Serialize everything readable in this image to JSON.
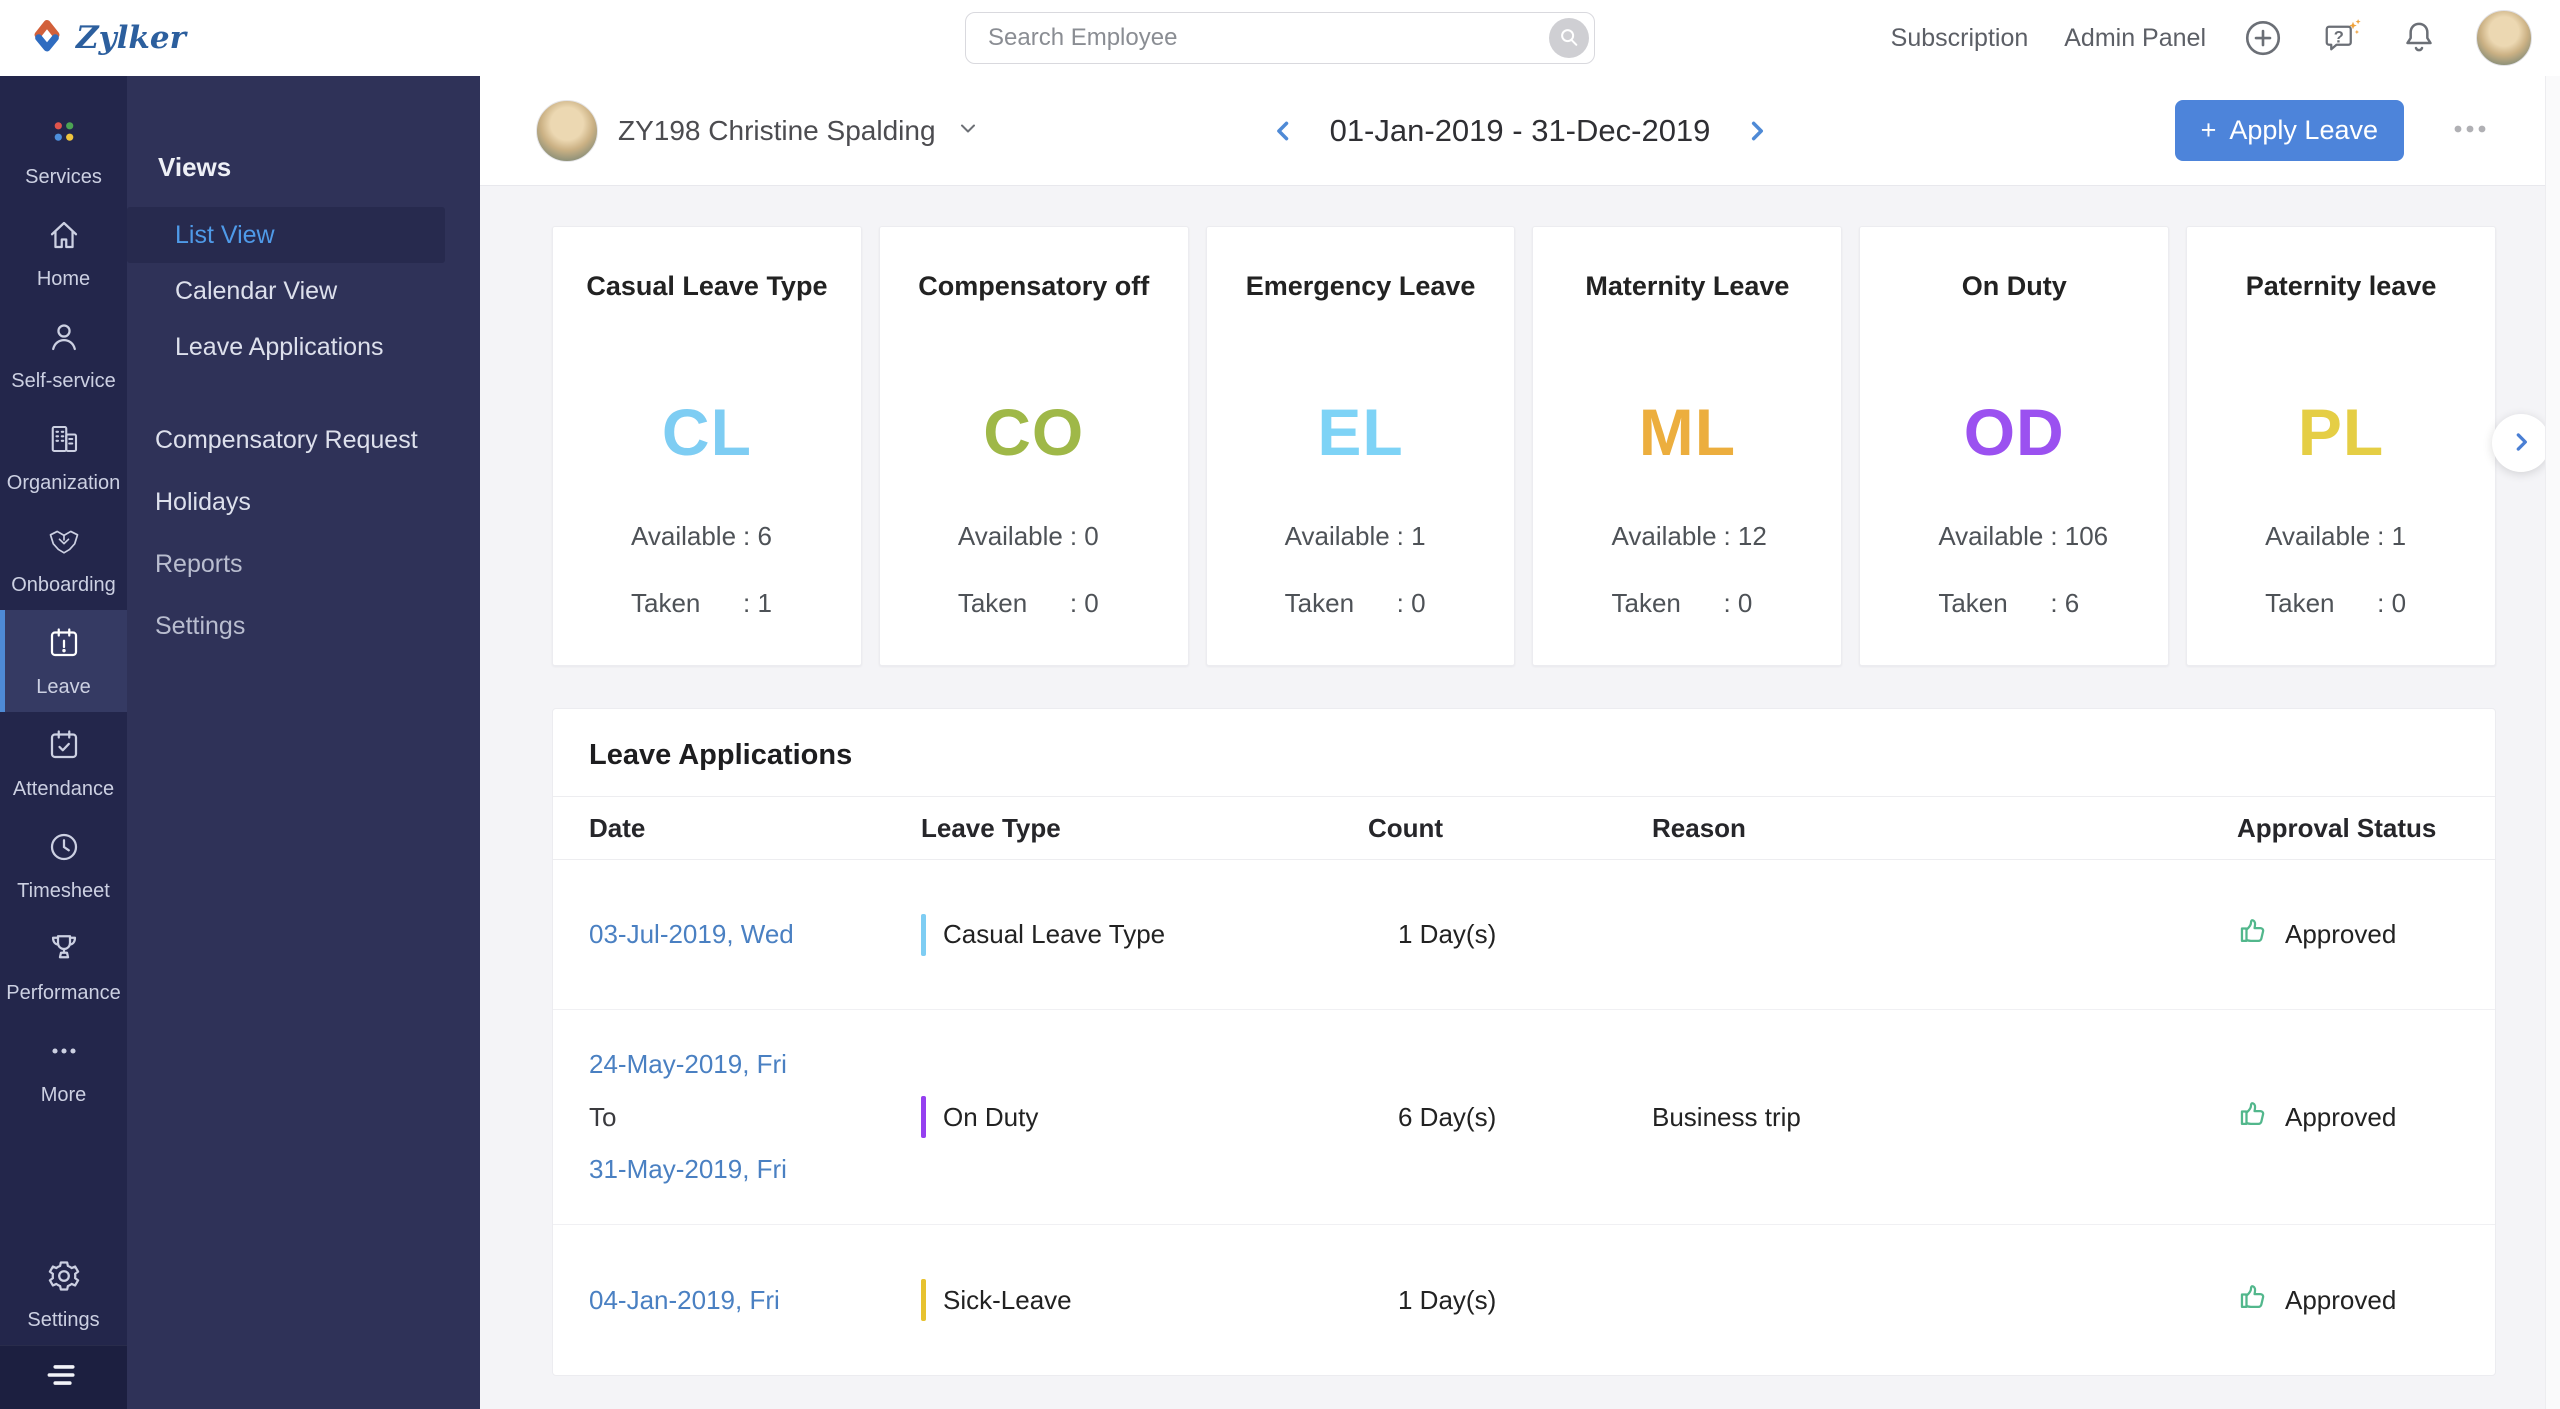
{
  "colors": {
    "accent_blue": "#4d84da",
    "link_blue": "#4a80c2",
    "approved_green": "#52b78c",
    "logo_blue": "#2c5f9e"
  },
  "topbar": {
    "logo_text": "Zylker",
    "search_placeholder": "Search Employee",
    "links": [
      {
        "label": "Subscription"
      },
      {
        "label": "Admin Panel"
      }
    ],
    "icons": [
      "plus-circle-icon",
      "help-bubble-icon",
      "bell-icon",
      "user-avatar"
    ]
  },
  "sidebar": {
    "items": [
      {
        "label": "Services",
        "icon": "services-grid-icon",
        "active": false
      },
      {
        "label": "Home",
        "icon": "home-icon",
        "active": false
      },
      {
        "label": "Self-service",
        "icon": "person-icon",
        "active": false
      },
      {
        "label": "Organization",
        "icon": "buildings-icon",
        "active": false
      },
      {
        "label": "Onboarding",
        "icon": "handshake-icon",
        "active": false
      },
      {
        "label": "Leave",
        "icon": "calendar-exclaim-icon",
        "active": true
      },
      {
        "label": "Attendance",
        "icon": "calendar-check-icon",
        "active": false
      },
      {
        "label": "Timesheet",
        "icon": "clock-icon",
        "active": false
      },
      {
        "label": "Performance",
        "icon": "trophy-icon",
        "active": false
      },
      {
        "label": "More",
        "icon": "ellipsis-icon",
        "active": false
      }
    ],
    "settings_label": "Settings"
  },
  "subsidebar": {
    "section_title": "Views",
    "views": [
      {
        "label": "List View",
        "active": true
      },
      {
        "label": "Calendar View",
        "active": false
      },
      {
        "label": "Leave Applications",
        "active": false
      }
    ],
    "links": [
      {
        "label": "Compensatory Request"
      },
      {
        "label": "Holidays"
      },
      {
        "label": "Reports"
      },
      {
        "label": "Settings"
      }
    ]
  },
  "header": {
    "employee": "ZY198 Christine Spalding",
    "date_range": "01-Jan-2019 - 31-Dec-2019",
    "apply_leave_label": "Apply Leave",
    "plus_sign": "+"
  },
  "cards": [
    {
      "title": "Casual Leave Type",
      "code": "CL",
      "color": "#7ecdf3",
      "stats": [
        {
          "label": "Available",
          "value": ": 6"
        },
        {
          "label": "Taken",
          "value": ": 1"
        }
      ]
    },
    {
      "title": "Compensatory off",
      "code": "CO",
      "color": "#9fb848",
      "stats": [
        {
          "label": "Available",
          "value": ": 0"
        },
        {
          "label": "Taken",
          "value": ": 0"
        }
      ]
    },
    {
      "title": "Emergency Leave",
      "code": "EL",
      "color": "#7ed3f6",
      "stats": [
        {
          "label": "Available",
          "value": ": 1"
        },
        {
          "label": "Taken",
          "value": ": 0"
        }
      ]
    },
    {
      "title": "Maternity Leave",
      "code": "ML",
      "color": "#ecae3e",
      "stats": [
        {
          "label": "Available",
          "value": ": 12"
        },
        {
          "label": "Taken",
          "value": ": 0"
        }
      ]
    },
    {
      "title": "On Duty",
      "code": "OD",
      "color": "#9b51f0",
      "stats": [
        {
          "label": "Available",
          "value": ": 106"
        },
        {
          "label": "Taken",
          "value": ": 6"
        }
      ]
    },
    {
      "title": "Paternity leave",
      "code": "PL",
      "color": "#e5ce45",
      "stats": [
        {
          "label": "Available",
          "value": ": 1"
        },
        {
          "label": "Taken",
          "value": ": 0"
        }
      ]
    }
  ],
  "table": {
    "title": "Leave Applications",
    "columns": [
      "Date",
      "Leave Type",
      "Count",
      "Reason",
      "Approval Status"
    ],
    "rows": [
      {
        "dates": [
          "03-Jul-2019, Wed"
        ],
        "type": "Casual Leave Type",
        "bar": "#7ecdf3",
        "count": "1 Day(s)",
        "reason": "",
        "status": "Approved"
      },
      {
        "dates": [
          "24-May-2019, Fri",
          "To",
          "31-May-2019, Fri"
        ],
        "type": "On Duty",
        "bar": "#9540f0",
        "count": "6 Day(s)",
        "reason": "Business trip",
        "status": "Approved"
      },
      {
        "dates": [
          "04-Jan-2019, Fri"
        ],
        "type": "Sick-Leave",
        "bar": "#e7c22f",
        "count": "1 Day(s)",
        "reason": "",
        "status": "Approved"
      }
    ]
  }
}
